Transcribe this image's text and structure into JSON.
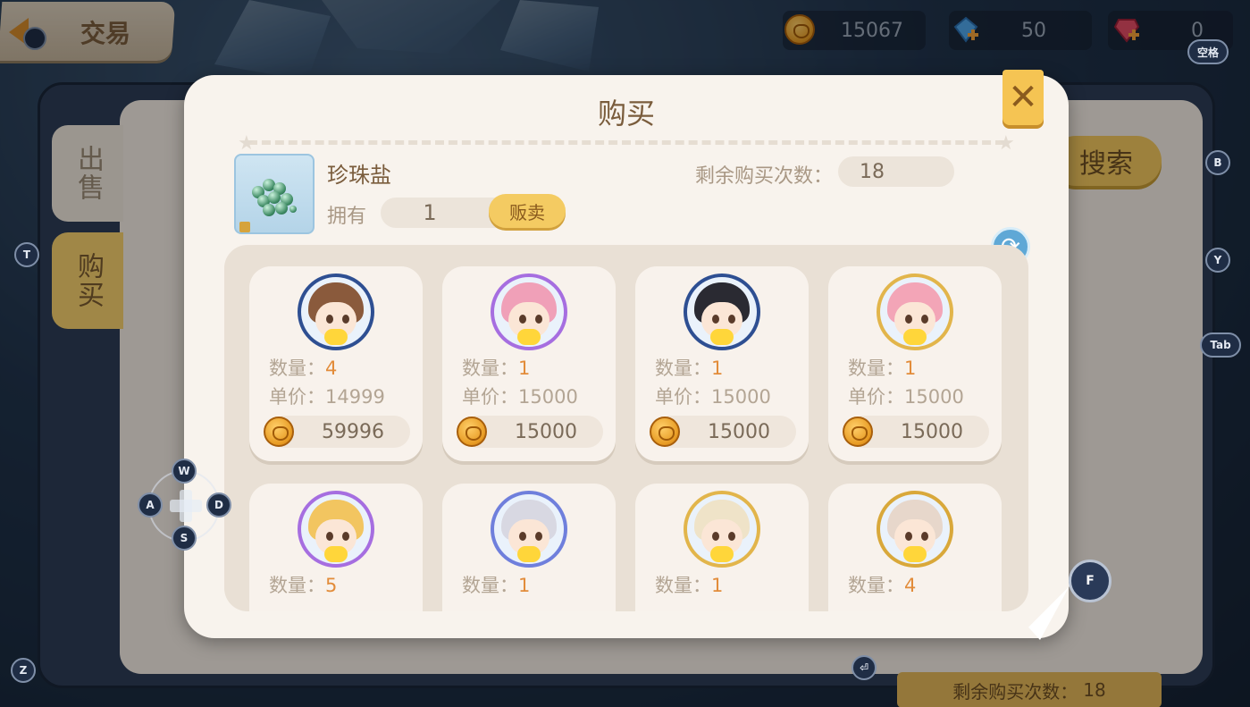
{
  "header": {
    "back_icon": "back-arrow-icon",
    "title": "交易"
  },
  "currencies": [
    {
      "name": "coin",
      "icon": "coin-icon",
      "value": "15067"
    },
    {
      "name": "diamond",
      "icon": "blue-gem-plus-icon",
      "value": "50"
    },
    {
      "name": "ruby",
      "icon": "red-gem-plus-icon",
      "value": "0"
    }
  ],
  "background_panel": {
    "tabs": [
      {
        "label": "出售",
        "selected": false
      },
      {
        "label": "购买",
        "selected": true
      }
    ],
    "search_label": "搜索",
    "remaining_label": "剩余购买次数：",
    "remaining_value": "18"
  },
  "modal": {
    "title": "购买",
    "close_icon": "close-icon",
    "refresh_icon": "refresh-icon",
    "item": {
      "name": "珍珠盐",
      "icon": "pearl-salt-icon",
      "owned_label": "拥有",
      "owned_value": "1",
      "sell_label": "贩卖",
      "remaining_label": "剩余购买次数：",
      "remaining_value": "18"
    },
    "qty_label": "数量：",
    "price_label": "单价：",
    "listings": [
      {
        "qty": "4",
        "unit_price": "14999",
        "total": "59996",
        "hair": "#8a5a3c",
        "frame": "#2e4f92"
      },
      {
        "qty": "1",
        "unit_price": "15000",
        "total": "15000",
        "hair": "#f0a0b8",
        "frame": "#a66ee0"
      },
      {
        "qty": "1",
        "unit_price": "15000",
        "total": "15000",
        "hair": "#2a2a32",
        "frame": "#2e4f92"
      },
      {
        "qty": "1",
        "unit_price": "15000",
        "total": "15000",
        "hair": "#f3a5b7",
        "frame": "#e2b54b"
      },
      {
        "qty": "5",
        "unit_price": "",
        "total": "",
        "hair": "#f2c560",
        "frame": "#a66ee0"
      },
      {
        "qty": "1",
        "unit_price": "",
        "total": "",
        "hair": "#d8d8e2",
        "frame": "#6f7fdc"
      },
      {
        "qty": "1",
        "unit_price": "",
        "total": "",
        "hair": "#efe3c8",
        "frame": "#e2b54b"
      },
      {
        "qty": "4",
        "unit_price": "",
        "total": "",
        "hair": "#e7d7cb",
        "frame": "#d9a83a"
      }
    ]
  },
  "key_hints": {
    "space": "空格",
    "b": "B",
    "y": "Y",
    "tab": "Tab",
    "t": "T",
    "z": "Z",
    "f": "F",
    "w": "W",
    "a": "A",
    "s": "S",
    "d": "D",
    "enter": "⏎"
  }
}
